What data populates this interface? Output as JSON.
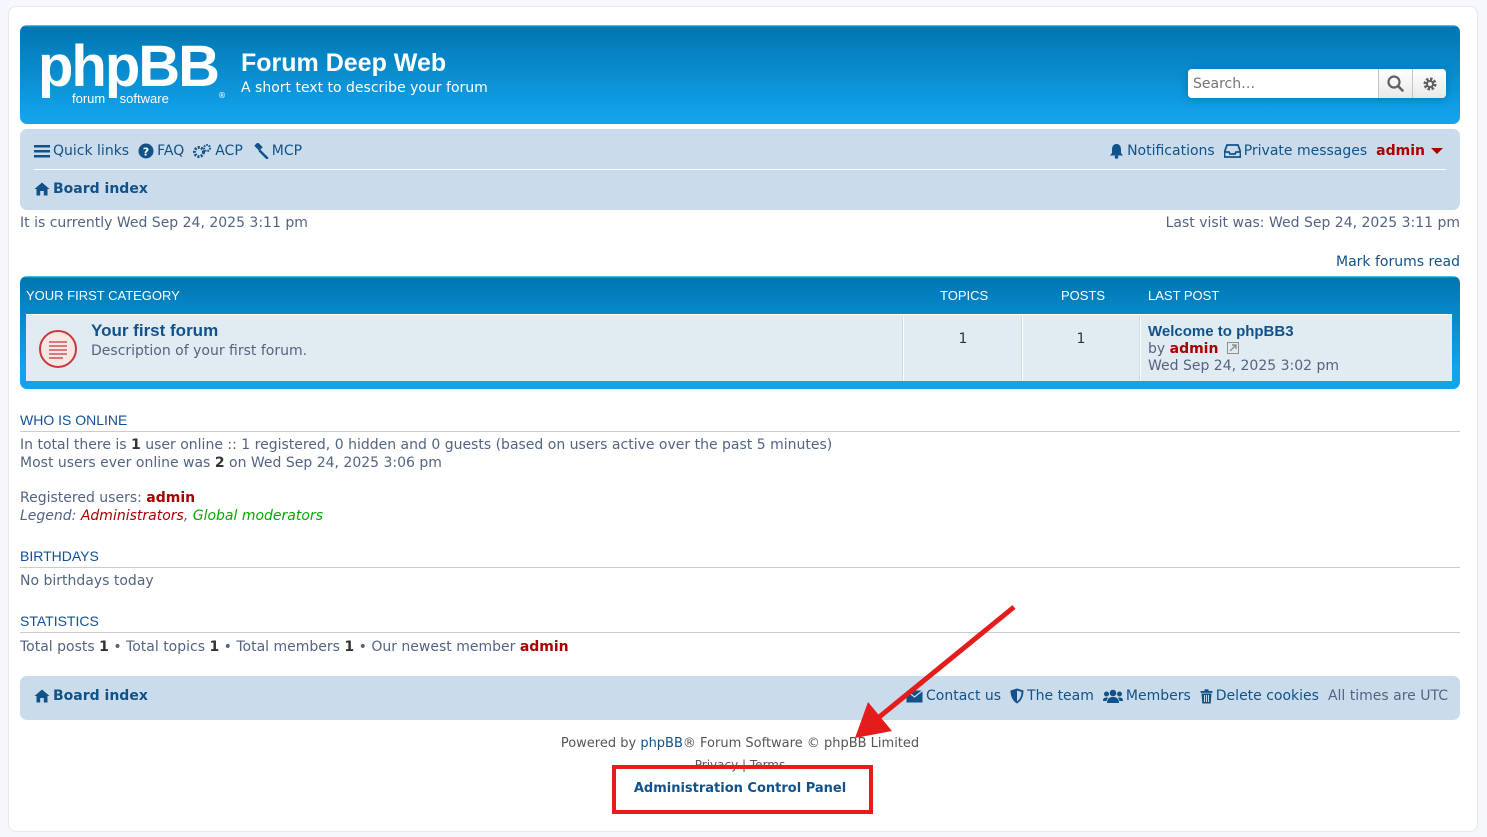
{
  "header": {
    "logo_big": "phpBB",
    "logo_small": "forum    software",
    "logo_reg": "®",
    "site_title": "Forum Deep Web",
    "site_description": "A short text to describe your forum",
    "search_placeholder": "Search…"
  },
  "navbar": {
    "quick_links": "Quick links",
    "faq": "FAQ",
    "acp": "ACP",
    "mcp": "MCP",
    "notifications": "Notifications",
    "private_messages": "Private messages",
    "username": "admin",
    "board_index": "Board index"
  },
  "times": {
    "current": "It is currently Wed Sep 24, 2025 3:11 pm",
    "last_visit": "Last visit was: Wed Sep 24, 2025 3:11 pm"
  },
  "mark_forums_read": "Mark forums read",
  "category": {
    "title": "YOUR FIRST CATEGORY",
    "col_topics": "TOPICS",
    "col_posts": "POSTS",
    "col_last_post": "LAST POST",
    "forums": [
      {
        "name": "Your first forum",
        "description": "Description of your first forum.",
        "topics": "1",
        "posts": "1",
        "last_post_title": "Welcome to phpBB3",
        "last_post_by": "by",
        "last_post_author": "admin",
        "last_post_time": "Wed Sep 24, 2025 3:02 pm"
      }
    ]
  },
  "who_is_online": {
    "title": "WHO IS ONLINE",
    "line1_a": "In total there is ",
    "line1_count": "1",
    "line1_b": " user online :: 1 registered, 0 hidden and 0 guests (based on users active over the past 5 minutes)",
    "line2_a": "Most users ever online was ",
    "line2_count": "2",
    "line2_b": " on Wed Sep 24, 2025 3:06 pm",
    "registered_label": "Registered users: ",
    "registered_user": "admin",
    "legend_label": "Legend: ",
    "legend_admins": "Administrators",
    "legend_sep": ", ",
    "legend_mods": "Global moderators"
  },
  "birthdays": {
    "title": "BIRTHDAYS",
    "text": "No birthdays today"
  },
  "statistics": {
    "title": "STATISTICS",
    "posts_label": "Total posts ",
    "posts": "1",
    "topics_label": " • Total topics ",
    "topics": "1",
    "members_label": " • Total members ",
    "members": "1",
    "newest_label": " • Our newest member ",
    "newest": "admin"
  },
  "footer_nav": {
    "board_index": "Board index",
    "contact_us": "Contact us",
    "the_team": "The team",
    "members": "Members",
    "delete_cookies": "Delete cookies",
    "timezone": "All times are UTC"
  },
  "copyright": {
    "powered_by": "Powered by ",
    "phpbb": "phpBB",
    "rest": "® Forum Software © phpBB Limited",
    "privacy": "Privacy",
    "sep": " | ",
    "terms": "Terms",
    "acp_link": "Administration Control Panel"
  },
  "colors": {
    "header_blue": "#12a3eb",
    "navbar_bg": "#cadceb",
    "link": "#105289",
    "admin_red": "#aa0000",
    "mod_green": "#00aa00",
    "annotation_red": "#e41c1c"
  }
}
